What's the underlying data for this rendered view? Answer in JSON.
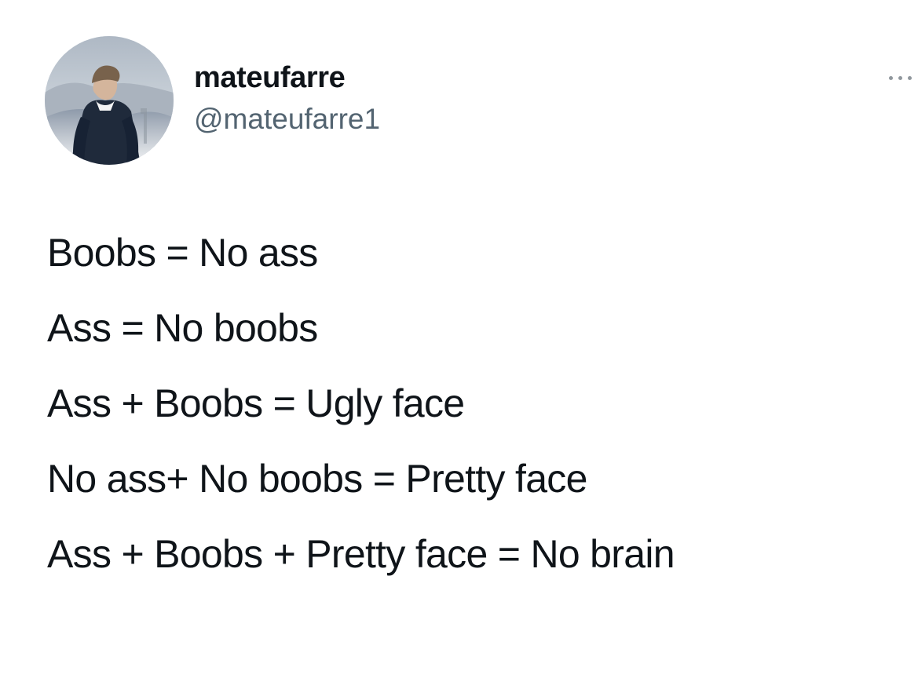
{
  "tweet": {
    "author": {
      "display_name": "mateufarre",
      "handle": "@mateufarre1"
    },
    "more_icon": "more-horizontal-icon",
    "lines": [
      "Boobs = No ass",
      "Ass = No boobs",
      "Ass + Boobs = Ugly face",
      "No ass+ No boobs = Pretty face",
      "Ass + Boobs + Pretty face = No brain"
    ]
  }
}
